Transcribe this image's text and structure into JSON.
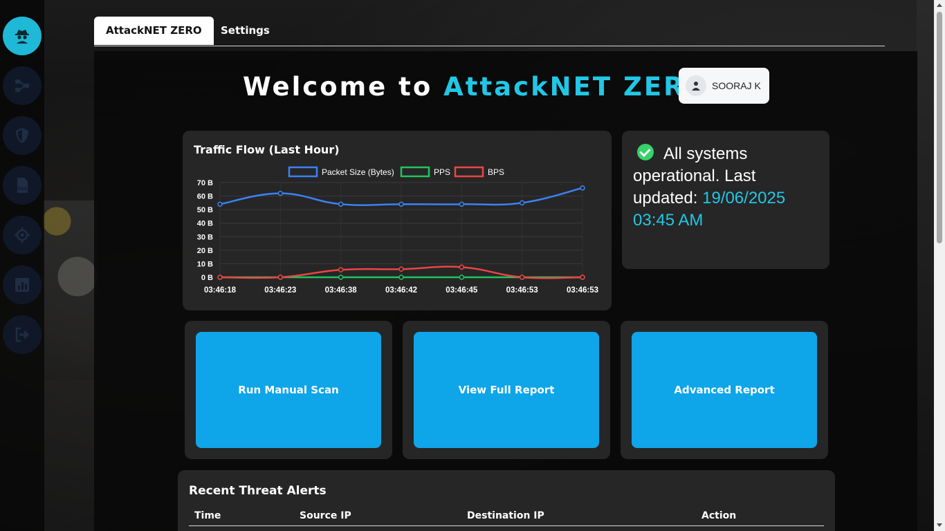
{
  "tabs": [
    {
      "label": "AttackNET ZERO",
      "active": true
    },
    {
      "label": "Settings",
      "active": false
    }
  ],
  "sidebar": {
    "items": [
      {
        "icon": "spy-icon",
        "active": true
      },
      {
        "icon": "network-icon",
        "active": false
      },
      {
        "icon": "shield-icon",
        "active": false
      },
      {
        "icon": "csv-file-icon",
        "active": false
      },
      {
        "icon": "crosshair-icon",
        "active": false
      },
      {
        "icon": "chart-icon",
        "active": false
      },
      {
        "icon": "logout-icon",
        "active": false
      }
    ],
    "active_color": "#1fb8d7"
  },
  "header": {
    "welcome_prefix": "Welcome to",
    "brand": "AttackNET ZERO",
    "accent_color": "#22c7e5",
    "user_name": "SOORAJ K"
  },
  "traffic_card": {
    "title": "Traffic Flow (Last Hour)"
  },
  "status": {
    "message": "All systems operational. Last updated:",
    "timestamp": "19/06/2025 03:45 AM",
    "ok_color": "#36d26b"
  },
  "actions": [
    {
      "label": "Run Manual Scan"
    },
    {
      "label": "View Full Report"
    },
    {
      "label": "Advanced Report"
    }
  ],
  "alerts": {
    "title": "Recent Threat Alerts",
    "columns": [
      "Time",
      "Source IP",
      "Destination IP",
      "Action"
    ]
  },
  "chart_data": {
    "type": "line",
    "title": "Traffic Flow (Last Hour)",
    "x": [
      "03:46:18",
      "03:46:23",
      "03:46:38",
      "03:46:42",
      "03:46:45",
      "03:46:53",
      "03:46:53"
    ],
    "series": [
      {
        "name": "Packet Size (Bytes)",
        "color": "#3b82f6",
        "values": [
          54,
          62,
          54,
          54,
          54,
          55,
          66
        ]
      },
      {
        "name": "PPS",
        "color": "#22c55e",
        "values": [
          0,
          0,
          0,
          0,
          0,
          0,
          0
        ]
      },
      {
        "name": "BPS",
        "color": "#ef4444",
        "values": [
          0,
          0,
          5.5,
          6,
          7.5,
          0,
          0
        ]
      }
    ],
    "y_ticks": [
      "70 B",
      "60 B",
      "50 B",
      "40 B",
      "30 B",
      "20 B",
      "10 B",
      "0 B"
    ],
    "ylim": [
      0,
      70
    ],
    "grid": true,
    "legend": "top-center"
  }
}
